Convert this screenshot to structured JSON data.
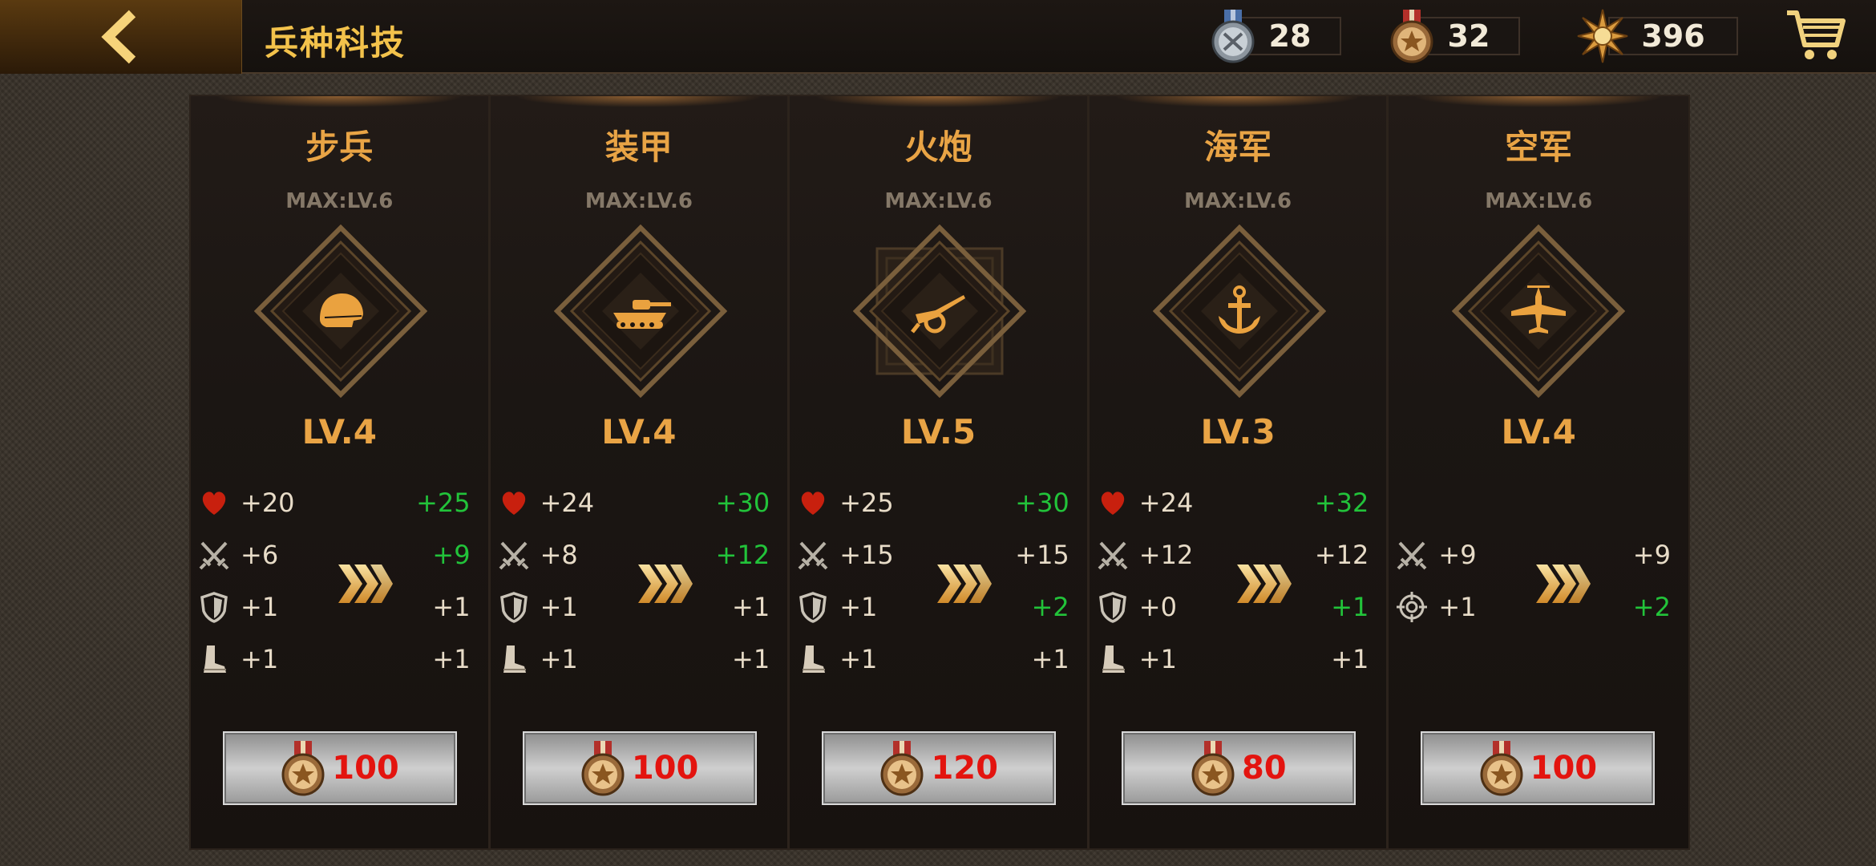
{
  "header": {
    "title": "兵种科技"
  },
  "resources": [
    {
      "name": "silver-medal",
      "value": "28"
    },
    {
      "name": "bronze-medal",
      "value": "32"
    },
    {
      "name": "star-badge",
      "value": "396"
    }
  ],
  "cards": [
    {
      "name": "步兵",
      "max": "MAX:LV.6",
      "level": "LV.4",
      "emblem": "helmet-icon",
      "stats": [
        {
          "icon": "heart-icon",
          "cur": "+20",
          "next": "+25",
          "up": true
        },
        {
          "icon": "swords-icon",
          "cur": "+6",
          "next": "+9",
          "up": true
        },
        {
          "icon": "shield-icon",
          "cur": "+1",
          "next": "+1",
          "up": false
        },
        {
          "icon": "boot-icon",
          "cur": "+1",
          "next": "+1",
          "up": false
        }
      ],
      "cost": "100"
    },
    {
      "name": "装甲",
      "max": "MAX:LV.6",
      "level": "LV.4",
      "emblem": "tank-icon",
      "stats": [
        {
          "icon": "heart-icon",
          "cur": "+24",
          "next": "+30",
          "up": true
        },
        {
          "icon": "swords-icon",
          "cur": "+8",
          "next": "+12",
          "up": true
        },
        {
          "icon": "shield-icon",
          "cur": "+1",
          "next": "+1",
          "up": false
        },
        {
          "icon": "boot-icon",
          "cur": "+1",
          "next": "+1",
          "up": false
        }
      ],
      "cost": "100"
    },
    {
      "name": "火炮",
      "max": "MAX:LV.6",
      "level": "LV.5",
      "emblem": "artillery-icon",
      "stats": [
        {
          "icon": "heart-icon",
          "cur": "+25",
          "next": "+30",
          "up": true
        },
        {
          "icon": "swords-icon",
          "cur": "+15",
          "next": "+15",
          "up": false
        },
        {
          "icon": "shield-icon",
          "cur": "+1",
          "next": "+2",
          "up": true
        },
        {
          "icon": "boot-icon",
          "cur": "+1",
          "next": "+1",
          "up": false
        }
      ],
      "cost": "120"
    },
    {
      "name": "海军",
      "max": "MAX:LV.6",
      "level": "LV.3",
      "emblem": "anchor-icon",
      "stats": [
        {
          "icon": "heart-icon",
          "cur": "+24",
          "next": "+32",
          "up": true
        },
        {
          "icon": "swords-icon",
          "cur": "+12",
          "next": "+12",
          "up": false
        },
        {
          "icon": "shield-icon",
          "cur": "+0",
          "next": "+1",
          "up": true
        },
        {
          "icon": "boot-icon",
          "cur": "+1",
          "next": "+1",
          "up": false
        }
      ],
      "cost": "80"
    },
    {
      "name": "空军",
      "max": "MAX:LV.6",
      "level": "LV.4",
      "emblem": "plane-icon",
      "stats": [
        {
          "icon": "swords-icon",
          "cur": "+9",
          "next": "+9",
          "up": false
        },
        {
          "icon": "crosshair-icon",
          "cur": "+1",
          "next": "+2",
          "up": true
        }
      ],
      "cost": "100"
    }
  ],
  "colors": {
    "accent_gold": "#e9a445",
    "title_yellow": "#f3c24b",
    "stat_up_green": "#22c33a",
    "cost_red": "#e3140f",
    "heart_red": "#c8200e"
  }
}
